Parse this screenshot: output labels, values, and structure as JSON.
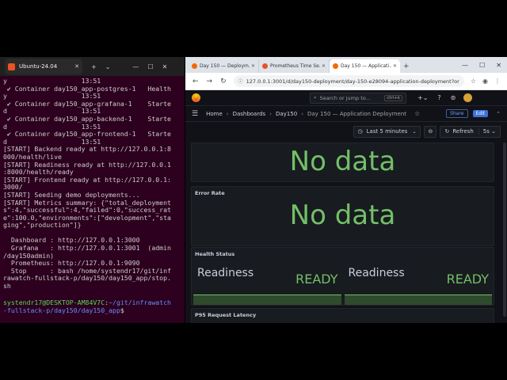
{
  "terminal": {
    "tab_title": "Ubuntu-24.04",
    "new_tab": "+",
    "dropdown": "⌄",
    "minimize": "—",
    "maximize": "☐",
    "close": "✕",
    "lines": [
      {
        "text": "y                   13:51",
        "cls": ""
      },
      {
        "text": " ✔ Container day150_app-postgres-1   Health",
        "cls": ""
      },
      {
        "text": "y                   13:51",
        "cls": ""
      },
      {
        "text": " ✔ Container day150_app-grafana-1    Starte",
        "cls": ""
      },
      {
        "text": "d                   13:51",
        "cls": ""
      },
      {
        "text": " ✔ Container day150_app-backend-1    Starte",
        "cls": ""
      },
      {
        "text": "d                   13:51",
        "cls": ""
      },
      {
        "text": " ✔ Container day150_app-frontend-1   Starte",
        "cls": ""
      },
      {
        "text": "d                   13:51",
        "cls": ""
      },
      {
        "text": "[START] Backend ready at http://127.0.0.1:8",
        "cls": "t-start"
      },
      {
        "text": "000/health/live",
        "cls": "t-start"
      },
      {
        "text": "[START] Readiness ready at http://127.0.0.1",
        "cls": "t-start"
      },
      {
        "text": ":8000/health/ready",
        "cls": "t-start"
      },
      {
        "text": "[START] Frontend ready at http://127.0.0.1:",
        "cls": "t-start"
      },
      {
        "text": "3000/",
        "cls": "t-start"
      },
      {
        "text": "[START] Seeding demo deployments...",
        "cls": "t-start"
      },
      {
        "text": "[START] Metrics summary: {\"total_deployment",
        "cls": "t-start"
      },
      {
        "text": "s\":4,\"successful\":4,\"failed\":0,\"success_rat",
        "cls": "t-start"
      },
      {
        "text": "e\":100.0,\"environments\":[\"development\",\"sta",
        "cls": "t-start"
      },
      {
        "text": "ging\",\"production\"]}",
        "cls": "t-start"
      },
      {
        "text": " ",
        "cls": ""
      },
      {
        "text": "  Dashboard : http://127.0.0.1:3000",
        "cls": ""
      },
      {
        "text": "  Grafana   : http://127.0.0.1:3001  (admin",
        "cls": ""
      },
      {
        "text": "/day150admin)",
        "cls": ""
      },
      {
        "text": "  Prometheus: http://127.0.0.1:9090",
        "cls": ""
      },
      {
        "text": "  Stop      : bash /home/systendr17/git/inf",
        "cls": ""
      },
      {
        "text": "rawatch-fullstack-p/day150/day150_app/stop.",
        "cls": ""
      },
      {
        "text": "sh",
        "cls": ""
      },
      {
        "text": " ",
        "cls": ""
      }
    ],
    "prompt_user": "systendr17@DESKTOP-AM84V7C",
    "prompt_sep": ":",
    "prompt_path_1": "~/git/infrawatch",
    "prompt_path_2": "-fullstack-p/day150/day150_app",
    "prompt_end": "$"
  },
  "browser": {
    "tabs": [
      {
        "title": "Day 150 — Deploym...",
        "fav": "#f46800",
        "close": "✕"
      },
      {
        "title": "Prometheus Time Se...",
        "fav": "#e6522c",
        "close": "✕"
      },
      {
        "title": "Day 150 — Applicati...",
        "fav": "#f46800",
        "close": "✕"
      }
    ],
    "new_tab": "+",
    "win_min": "—",
    "win_max": "☐",
    "win_close": "✕",
    "back": "←",
    "forward": "→",
    "reload": "↻",
    "url": "127.0.0.1:3001/d/day150-deployment/day-150-e28094-application-deployment?or...",
    "star_icon": "☆",
    "profile_icon": "◉",
    "menu_icon": "⋮"
  },
  "grafana": {
    "search_placeholder": "Search or jump to...",
    "search_kbd": "ctrl+k",
    "plus_icon": "+⌄",
    "help_icon": "?",
    "news_icon": "⊚",
    "bell_icon": "⊙",
    "menu_icon": "☰",
    "breadcrumbs": [
      "Home",
      "Dashboards",
      "Day150",
      "Day 150 — Application Deployment"
    ],
    "sep": "›",
    "star": "☆",
    "share": "Share",
    "edit": "Edit",
    "collapse": "⌃",
    "time_icon": "◷",
    "time_range": "Last 5 minutes",
    "chev": "⌄",
    "zoom": "⊖",
    "refresh_icon": "↻",
    "refresh": "Refresh",
    "interval": "5s ⌄",
    "panel1_nodata": "No data",
    "panel2_title": "Error Rate",
    "panel2_nodata": "No data",
    "panel3_title": "Health Status",
    "health": [
      {
        "label": "Readiness",
        "value": "READY"
      },
      {
        "label": "Readiness",
        "value": "READY"
      }
    ],
    "panel4_title": "P95 Request Latency"
  }
}
